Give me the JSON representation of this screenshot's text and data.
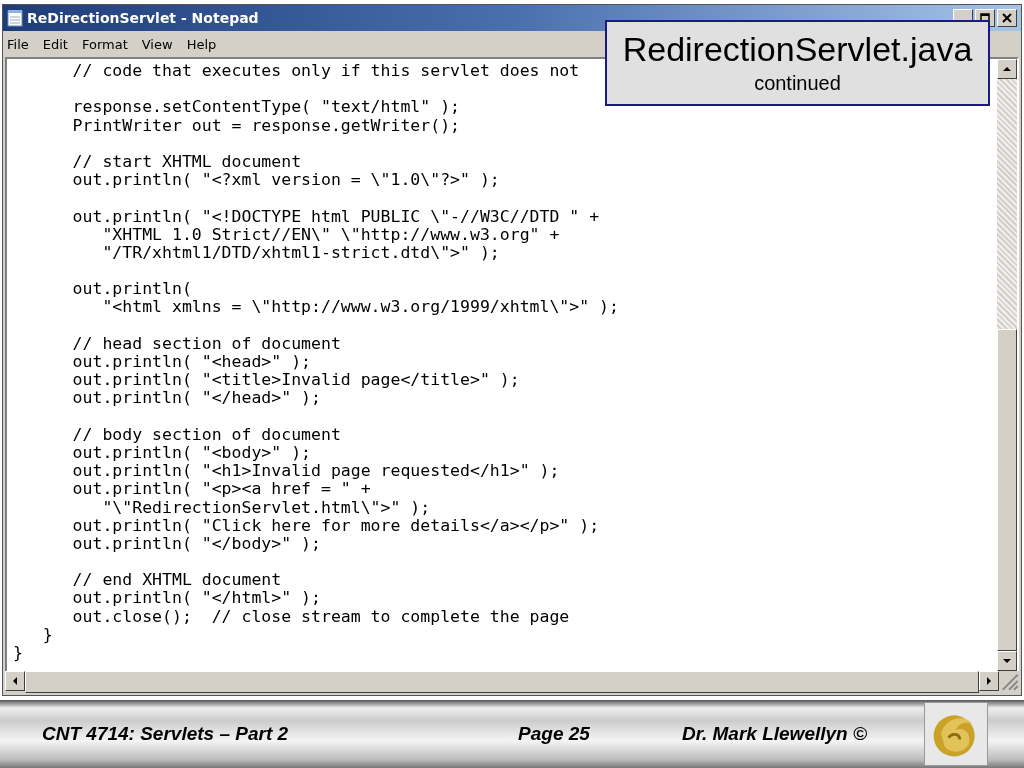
{
  "window": {
    "title": "ReDirectionServlet - Notepad"
  },
  "menu": [
    "File",
    "Edit",
    "Format",
    "View",
    "Help"
  ],
  "code_blocks": [
    [
      "      // code that executes only if this servlet does not"
    ],
    [
      "      response.setContentType( \"text/html\" );",
      "      PrintWriter out = response.getWriter();"
    ],
    [
      "      // start XHTML document",
      "      out.println( \"<?xml version = \\\"1.0\\\"?>\" );"
    ],
    [
      "      out.println( \"<!DOCTYPE html PUBLIC \\\"-//W3C//DTD \" +",
      "         \"XHTML 1.0 Strict//EN\\\" \\\"http://www.w3.org\" +",
      "         \"/TR/xhtml1/DTD/xhtml1-strict.dtd\\\">\" );"
    ],
    [
      "      out.println(",
      "         \"<html xmlns = \\\"http://www.w3.org/1999/xhtml\\\">\" );"
    ],
    [
      "      // head section of document",
      "      out.println( \"<head>\" );",
      "      out.println( \"<title>Invalid page</title>\" );",
      "      out.println( \"</head>\" );"
    ],
    [
      "      // body section of document",
      "      out.println( \"<body>\" );",
      "      out.println( \"<h1>Invalid page requested</h1>\" );",
      "      out.println( \"<p><a href = \" +",
      "         \"\\\"RedirectionServlet.html\\\">\" );",
      "      out.println( \"Click here for more details</a></p>\" );",
      "      out.println( \"</body>\" );"
    ],
    [
      "      // end XHTML document",
      "      out.println( \"</html>\" );",
      "      out.close();  // close stream to complete the page",
      "   }",
      "}"
    ]
  ],
  "callout": {
    "title": "RedirectionServlet.java",
    "subtitle": "continued"
  },
  "footer": {
    "course": "CNT 4714: Servlets – Part 2",
    "page": "Page 25",
    "author": "Dr. Mark Llewellyn ©"
  }
}
